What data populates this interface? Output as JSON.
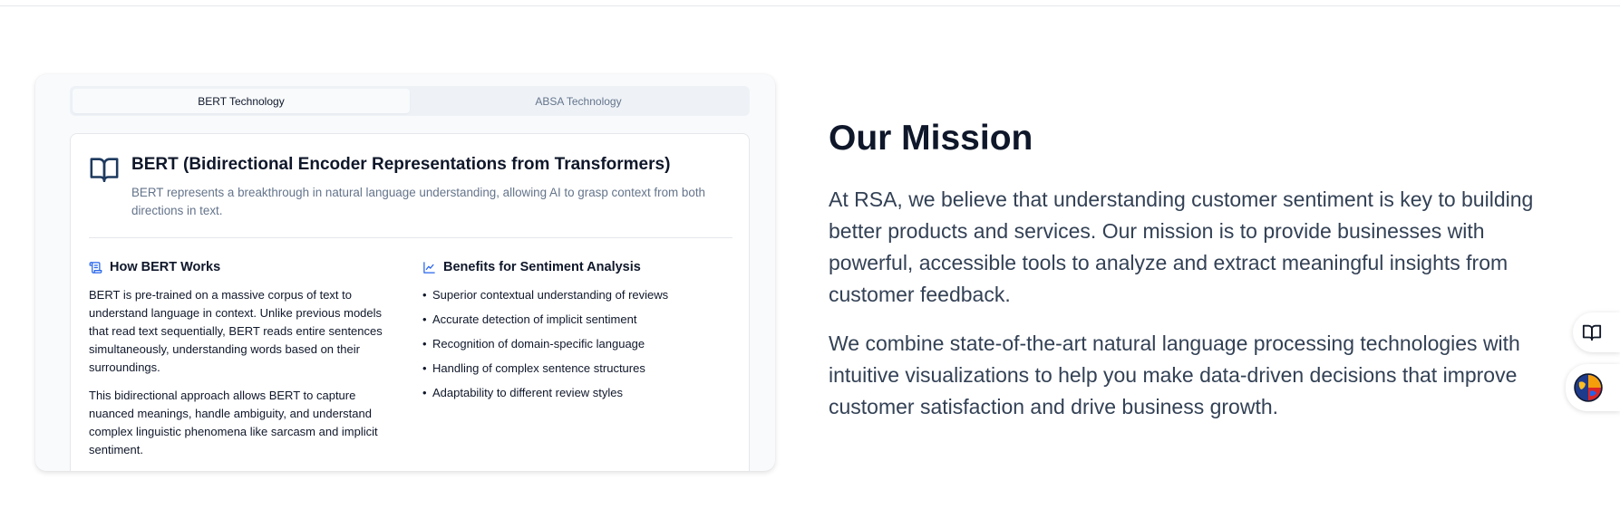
{
  "tabs": [
    {
      "label": "BERT Technology",
      "active": true
    },
    {
      "label": "ABSA Technology",
      "active": false
    }
  ],
  "bert_panel": {
    "icon": "open-book-icon",
    "title": "BERT (Bidirectional Encoder Representations from Transformers)",
    "description": "BERT represents a breakthrough in natural language understanding, allowing AI to grasp context from both directions in text.",
    "how_it_works": {
      "icon": "scroll-icon",
      "heading": "How BERT Works",
      "paragraphs": [
        "BERT is pre-trained on a massive corpus of text to understand language in context. Unlike previous models that read text sequentially, BERT reads entire sentences simultaneously, understanding words based on their surroundings.",
        "This bidirectional approach allows BERT to capture nuanced meanings, handle ambiguity, and understand complex linguistic phenomena like sarcasm and implicit sentiment."
      ]
    },
    "benefits": {
      "icon": "line-chart-icon",
      "heading": "Benefits for Sentiment Analysis",
      "items": [
        "Superior contextual understanding of reviews",
        "Accurate detection of implicit sentiment",
        "Recognition of domain-specific language",
        "Handling of complex sentence structures",
        "Adaptability to different review styles"
      ]
    }
  },
  "mission": {
    "heading": "Our Mission",
    "paragraphs": [
      "At RSA, we believe that understanding customer sentiment is key to building better products and services. Our mission is to provide businesses with powerful, accessible tools to analyze and extract meaningful insights from customer feedback.",
      "We combine state-of-the-art natural language processing technologies with intuitive visualizations to help you make data-driven decisions that improve customer satisfaction and drive business growth."
    ]
  },
  "floating_buttons": [
    {
      "icon": "book-icon"
    },
    {
      "icon": "globe-avatar-icon"
    }
  ],
  "colors": {
    "heading": "#0f172a",
    "muted": "#64748b",
    "body_text": "#334155",
    "accent_blue": "#2563eb",
    "card_bg": "#f8fafc"
  }
}
